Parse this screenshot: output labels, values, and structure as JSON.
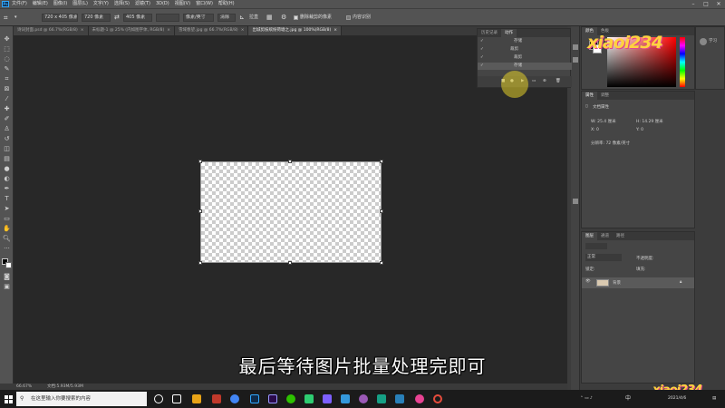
{
  "menu": {
    "logo": "Ps",
    "items": [
      "文件(F)",
      "编辑(E)",
      "图像(I)",
      "图层(L)",
      "文字(Y)",
      "选择(S)",
      "滤镜(T)",
      "3D(D)",
      "视图(V)",
      "窗口(W)",
      "帮助(H)"
    ]
  },
  "options": {
    "preset": "720 x 405 像素",
    "width": "720 像素",
    "height": "405 像素",
    "resolution": "",
    "unit": "像素/英寸",
    "clear": "清除",
    "straighten": "拉直",
    "delete_cropped": "删除裁剪的像素",
    "content_aware": "内容识别"
  },
  "tabs": [
    {
      "label": "诗词封面.psd @ 66.7%(RGB/8)",
      "active": false
    },
    {
      "label": "未标题-1 @ 25% (内如图字体, RGB/8)",
      "active": false
    },
    {
      "label": "雪域春望.jpg @ 66.7%(RGB/8)",
      "active": false
    },
    {
      "label": "出城剪枝缤纷荷塘之.jpg @ 100%(RGB/8)",
      "active": true
    }
  ],
  "status": {
    "zoom": "66.67%",
    "doc": "文档:5.93M/5.93M"
  },
  "subtitle": "最后等待图片批量处理完即可",
  "actions_panel": {
    "tabs": [
      "历史记录",
      "动作"
    ],
    "rows": [
      "存储",
      "裁剪",
      "裁剪",
      "存储"
    ]
  },
  "color_panel": {
    "tabs": [
      "颜色",
      "色板"
    ],
    "learn_label": "学习"
  },
  "properties": {
    "tabs": [
      "属性",
      "调整"
    ],
    "doc_props": "文档属性",
    "w": "W: 25.4 厘米",
    "h": "H: 14.29 厘米",
    "x": "X: 0",
    "y": "Y: 0",
    "resolution": "分辨率: 72 像素/英寸"
  },
  "layers": {
    "tabs": [
      "图层",
      "通道",
      "路径"
    ],
    "mode": "正常",
    "opacity_label": "不透明度:",
    "lock_label": "锁定:",
    "fill_label": "填充:",
    "layer_name": "背景"
  },
  "taskbar": {
    "search_placeholder": "在这里输入你要搜索的内容",
    "lang": "中",
    "date": "2021/4/6"
  },
  "watermark": "xiaoi234",
  "colors": {
    "chrome": "#535353",
    "canvas_bg": "#282828",
    "panel": "#454545",
    "taskbar": "#1b1b1b"
  }
}
